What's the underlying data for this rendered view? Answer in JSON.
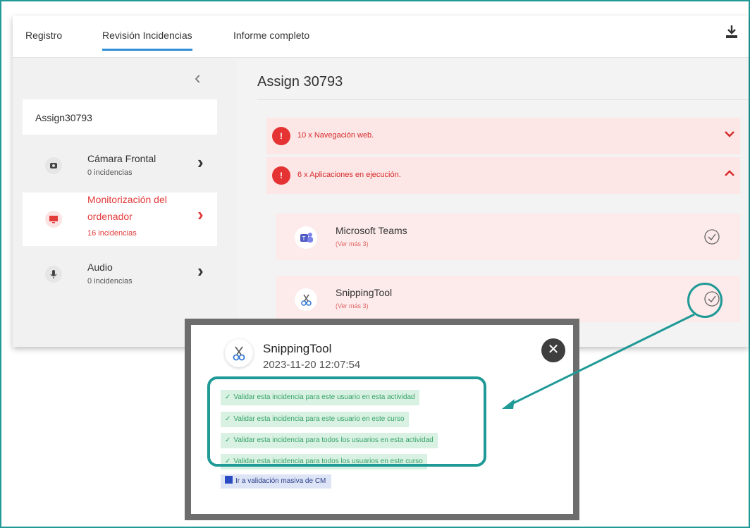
{
  "tabs": [
    {
      "label": "Registro"
    },
    {
      "label": "Revisión Incidencias"
    },
    {
      "label": "Informe completo"
    }
  ],
  "sidebar": {
    "assign_label": "Assign30793",
    "items": [
      {
        "title": "Cámara Frontal",
        "subtitle": "0 incidencias",
        "icon": "camera-icon"
      },
      {
        "title": "Monitorización del",
        "title2": "ordenador",
        "subtitle": "16 incidencias",
        "icon": "monitor-icon"
      },
      {
        "title": "Audio",
        "subtitle": "0 incidencias",
        "icon": "microphone-icon"
      }
    ]
  },
  "main": {
    "title": "Assign 30793",
    "incidents": [
      {
        "label": "10 x Navegación web.",
        "expanded": false
      },
      {
        "label": "6 x Aplicaciones en ejecución.",
        "expanded": true
      }
    ],
    "apps": [
      {
        "name": "Microsoft Teams",
        "more": "(Ver más 3)"
      },
      {
        "name": "SnippingTool",
        "more": "(Ver más 3)"
      }
    ]
  },
  "popup": {
    "title": "SnippingTool",
    "date": "2023-11-20 12:07:54",
    "options": [
      "Validar esta incidencia para este usuario en esta actividad",
      "Validar esta incidencia para este usuario en este curso",
      "Validar esta incidencia para todos los usuarios en esta actividad",
      "Validar esta incidencia para todos los usuarios en este curso"
    ],
    "massive_label": "Ir a validación masiva de CM"
  },
  "colors": {
    "accent_teal": "#1f9a96",
    "alert_red": "#e53333",
    "tab_blue": "#2f8fd6",
    "option_green": "#36a36a"
  }
}
